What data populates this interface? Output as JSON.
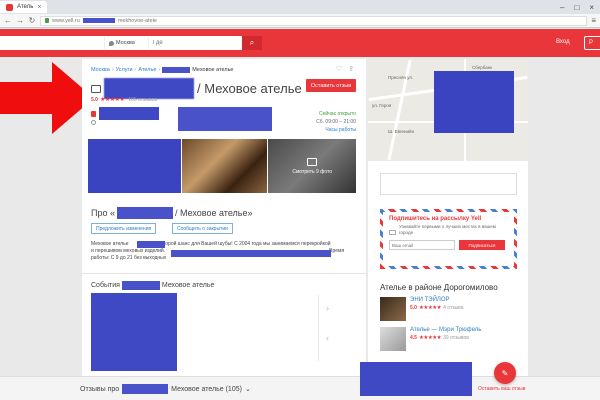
{
  "browser": {
    "tab_label": "Атель",
    "url_prefix": "www.yell.ru",
    "url_suffix": "mekhovoe-atele"
  },
  "header": {
    "search_where_placeholder": "Где",
    "location": "Москва",
    "login": "Вход",
    "register": "Р"
  },
  "breadcrumb": {
    "items": [
      "Москва",
      "Услуги",
      "Ателье"
    ],
    "current": "Меховое ателье"
  },
  "company": {
    "title_suffix": "/ Меховое ателье",
    "rating": "5.0",
    "stars": "★★★★★",
    "review_count": "105 отзывов",
    "leave_review": "Оставить отзыв",
    "status_open": "Сейчас открыто",
    "hours": "Сб. 09:00 – 21:00",
    "hours_link": "Часы работы",
    "gallery_more": "Смотреть 9 фото"
  },
  "about": {
    "prefix": "Про «",
    "suffix": "/ Меховое ателье»",
    "suggest_btn": "Предложить изменения",
    "report_btn": "Сообщить о закрытии",
    "desc_line1_a": "Меховое ателье",
    "desc_line1_b": "второй шанс для Вашей шубы! С 2004 года мы занимаемся перекройкой",
    "desc_line2_a": "и перешивом меховых изделий.",
    "desc_line2_b": "Время",
    "desc_line3": "работы: С 9 до 21 без выходных"
  },
  "events": {
    "prefix": "События",
    "suffix": "Меховое ателье"
  },
  "map": {
    "labels": [
      "Пресняя ул.",
      "Сбербанк",
      "ул. Героя",
      "Ш. Евгенийн"
    ]
  },
  "subscribe": {
    "title": "Подпишитесь на рассылку Yell",
    "text": "Узнавайте первыми о лучших местах в вашем городе",
    "email_placeholder": "Ваш email",
    "button": "Подписаться"
  },
  "nearby": {
    "title": "Ателье в районе Дорогомилово",
    "items": [
      {
        "name": "ЭНИ ТЭЙЛОР",
        "score": "5.0",
        "stars": "★★★★★",
        "count": "4 отзыва"
      },
      {
        "name": "Ателье — Мэри Трюфель",
        "score": "4.5",
        "stars": "★★★★★",
        "count": "39 отзывов"
      }
    ]
  },
  "bottom": {
    "reviews_prefix": "Отзывы про",
    "reviews_suffix": "Меховое ателье (105)",
    "fab_label": "Оставить ваш отзыв"
  }
}
